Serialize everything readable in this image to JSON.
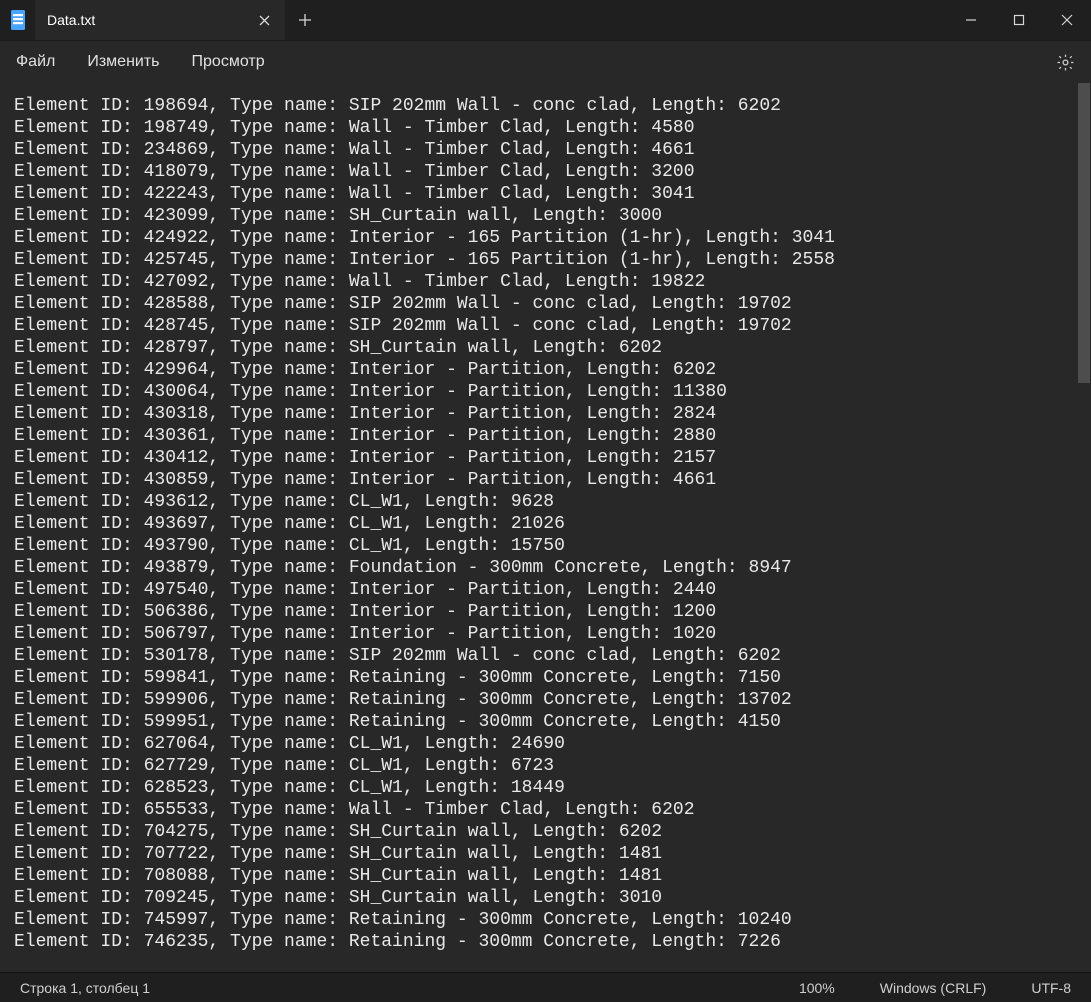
{
  "tab": {
    "title": "Data.txt"
  },
  "menu": {
    "file": "Файл",
    "edit": "Изменить",
    "view": "Просмотр"
  },
  "status": {
    "cursor": "Строка 1, столбец 1",
    "zoom": "100%",
    "line_ending": "Windows (CRLF)",
    "encoding": "UTF-8"
  },
  "lines": [
    {
      "id": 198694,
      "type": "SIP 202mm Wall - conc clad",
      "length": 6202
    },
    {
      "id": 198749,
      "type": "Wall - Timber Clad",
      "length": 4580
    },
    {
      "id": 234869,
      "type": "Wall - Timber Clad",
      "length": 4661
    },
    {
      "id": 418079,
      "type": "Wall - Timber Clad",
      "length": 3200
    },
    {
      "id": 422243,
      "type": "Wall - Timber Clad",
      "length": 3041
    },
    {
      "id": 423099,
      "type": "SH_Curtain wall",
      "length": 3000
    },
    {
      "id": 424922,
      "type": "Interior - 165 Partition (1-hr)",
      "length": 3041
    },
    {
      "id": 425745,
      "type": "Interior - 165 Partition (1-hr)",
      "length": 2558
    },
    {
      "id": 427092,
      "type": "Wall - Timber Clad",
      "length": 19822
    },
    {
      "id": 428588,
      "type": "SIP 202mm Wall - conc clad",
      "length": 19702
    },
    {
      "id": 428745,
      "type": "SIP 202mm Wall - conc clad",
      "length": 19702
    },
    {
      "id": 428797,
      "type": "SH_Curtain wall",
      "length": 6202
    },
    {
      "id": 429964,
      "type": "Interior - Partition",
      "length": 6202
    },
    {
      "id": 430064,
      "type": "Interior - Partition",
      "length": 11380
    },
    {
      "id": 430318,
      "type": "Interior - Partition",
      "length": 2824
    },
    {
      "id": 430361,
      "type": "Interior - Partition",
      "length": 2880
    },
    {
      "id": 430412,
      "type": "Interior - Partition",
      "length": 2157
    },
    {
      "id": 430859,
      "type": "Interior - Partition",
      "length": 4661
    },
    {
      "id": 493612,
      "type": "CL_W1",
      "length": 9628
    },
    {
      "id": 493697,
      "type": "CL_W1",
      "length": 21026
    },
    {
      "id": 493790,
      "type": "CL_W1",
      "length": 15750
    },
    {
      "id": 493879,
      "type": "Foundation - 300mm Concrete",
      "length": 8947
    },
    {
      "id": 497540,
      "type": "Interior - Partition",
      "length": 2440
    },
    {
      "id": 506386,
      "type": "Interior - Partition",
      "length": 1200
    },
    {
      "id": 506797,
      "type": "Interior - Partition",
      "length": 1020
    },
    {
      "id": 530178,
      "type": "SIP 202mm Wall - conc clad",
      "length": 6202
    },
    {
      "id": 599841,
      "type": "Retaining - 300mm Concrete",
      "length": 7150
    },
    {
      "id": 599906,
      "type": "Retaining - 300mm Concrete",
      "length": 13702
    },
    {
      "id": 599951,
      "type": "Retaining - 300mm Concrete",
      "length": 4150
    },
    {
      "id": 627064,
      "type": "CL_W1",
      "length": 24690
    },
    {
      "id": 627729,
      "type": "CL_W1",
      "length": 6723
    },
    {
      "id": 628523,
      "type": "CL_W1",
      "length": 18449
    },
    {
      "id": 655533,
      "type": "Wall - Timber Clad",
      "length": 6202
    },
    {
      "id": 704275,
      "type": "SH_Curtain wall",
      "length": 6202
    },
    {
      "id": 707722,
      "type": "SH_Curtain wall",
      "length": 1481
    },
    {
      "id": 708088,
      "type": "SH_Curtain wall",
      "length": 1481
    },
    {
      "id": 709245,
      "type": "SH_Curtain wall",
      "length": 3010
    },
    {
      "id": 745997,
      "type": "Retaining - 300mm Concrete",
      "length": 10240
    },
    {
      "id": 746235,
      "type": "Retaining - 300mm Concrete",
      "length": 7226
    }
  ]
}
